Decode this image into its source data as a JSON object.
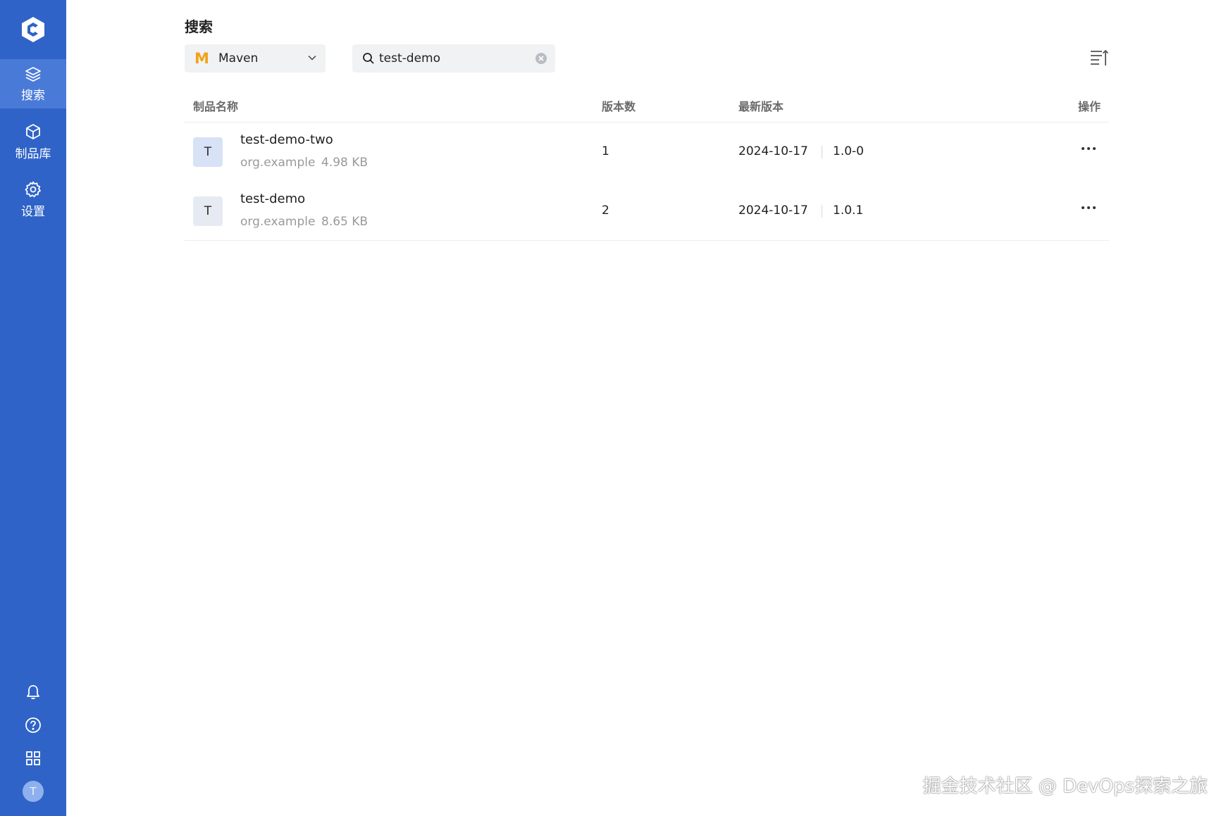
{
  "sidebar": {
    "nav": [
      {
        "label": "搜索",
        "icon": "layers-icon",
        "active": true
      },
      {
        "label": "制品库",
        "icon": "cube-icon",
        "active": false
      },
      {
        "label": "设置",
        "icon": "gear-icon",
        "active": false
      }
    ],
    "bottom_icons": [
      "bell-icon",
      "help-circle-icon",
      "grid-icon"
    ],
    "avatar_initial": "T"
  },
  "page": {
    "title": "搜索"
  },
  "toolbar": {
    "repo_type": {
      "logo_letter": "M",
      "selected": "Maven"
    },
    "search": {
      "value": "test-demo"
    }
  },
  "table": {
    "headers": [
      "制品名称",
      "版本数",
      "最新版本",
      "操作"
    ],
    "rows": [
      {
        "initial": "T",
        "name": "test-demo-two",
        "group": "org.example",
        "size": "4.98 KB",
        "versions": "1",
        "date": "2024-10-17",
        "latest": "1.0-0"
      },
      {
        "initial": "T",
        "name": "test-demo",
        "group": "org.example",
        "size": "8.65 KB",
        "versions": "2",
        "date": "2024-10-17",
        "latest": "1.0.1"
      }
    ]
  },
  "watermark": "掘金技术社区 @ DevOps探索之旅",
  "colors": {
    "sidebar_bg": "#2f63c7",
    "sidebar_active": "#4a7ad8",
    "maven_orange": "#f2a21b"
  }
}
